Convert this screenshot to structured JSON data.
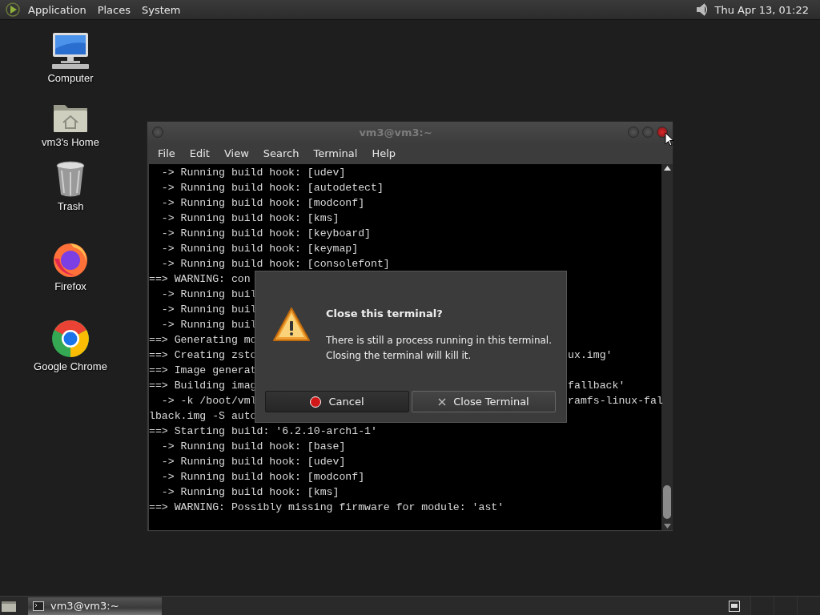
{
  "top_panel": {
    "menus": [
      "Application",
      "Places",
      "System"
    ],
    "clock": "Thu Apr 13, 01:22"
  },
  "desktop_icons": [
    {
      "label": "Computer",
      "kind": "computer"
    },
    {
      "label": "vm3's Home",
      "kind": "home"
    },
    {
      "label": "Trash",
      "kind": "trash"
    },
    {
      "label": "Firefox",
      "kind": "firefox"
    },
    {
      "label": "Google Chrome",
      "kind": "chrome"
    }
  ],
  "terminal": {
    "title": "vm3@vm3:~",
    "menu": [
      "File",
      "Edit",
      "View",
      "Search",
      "Terminal",
      "Help"
    ],
    "lines": [
      {
        "text": "  -> Running build hook: [udev]"
      },
      {
        "text": "  -> Running build hook: [autodetect]"
      },
      {
        "text": "  -> Running build hook: [modconf]"
      },
      {
        "text": "  -> Running build hook: [kms]"
      },
      {
        "text": "  -> Running build hook: [keyboard]"
      },
      {
        "text": "  -> Running build hook: [keymap]"
      },
      {
        "text": "  -> Running build hook: [consolefont]"
      },
      {
        "text": "==> WARNING: con"
      },
      {
        "text": "  -> Running buil"
      },
      {
        "text": "  -> Running buil"
      },
      {
        "text": "  -> Running buil"
      },
      {
        "text": "==> Generating mo"
      },
      {
        "text": "==> Creating zsto",
        "right": "ux.img'"
      },
      {
        "text": "==> Image generat"
      },
      {
        "text": "==> Building imag",
        "right": "fallback'"
      },
      {
        "text": "  -> -k /boot/vml",
        "right": "ramfs-linux-fal"
      },
      {
        "text": "lback.img -S auto"
      },
      {
        "text": "==> Starting build: '6.2.10-arch1-1'"
      },
      {
        "text": "  -> Running build hook: [base]"
      },
      {
        "text": "  -> Running build hook: [udev]"
      },
      {
        "text": "  -> Running build hook: [modconf]"
      },
      {
        "text": "  -> Running build hook: [kms]"
      },
      {
        "text": "==> WARNING: Possibly missing firmware for module: 'ast'"
      }
    ]
  },
  "dialog": {
    "title": "Close this terminal?",
    "message": "There is still a process running in this terminal. Closing the terminal will kill it.",
    "buttons": [
      {
        "label": "Cancel",
        "kind": "cancel"
      },
      {
        "label": "Close Terminal",
        "kind": "close"
      }
    ]
  },
  "taskbar": {
    "items": [
      {
        "label": "vm3@vm3:~",
        "selected": true
      }
    ]
  }
}
